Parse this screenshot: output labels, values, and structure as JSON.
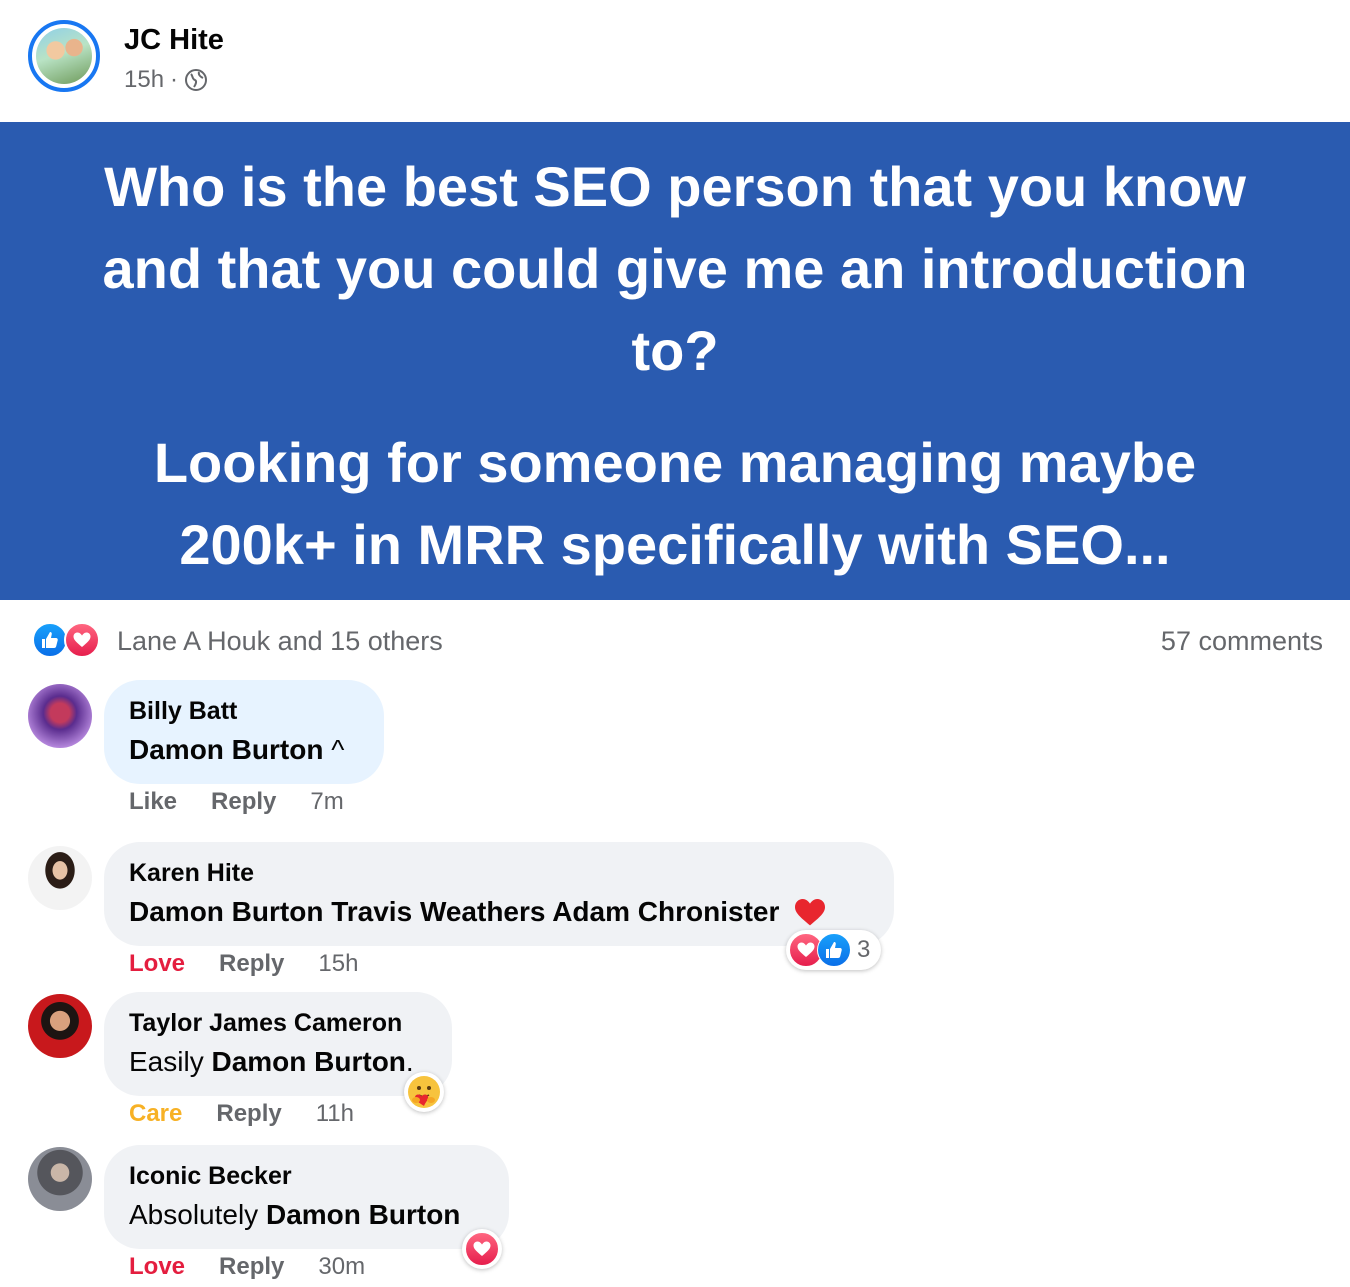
{
  "post": {
    "author": "JC Hite",
    "time": "15h",
    "separator": "·",
    "banner_color": "#2a5bb0",
    "question_lines": [
      "Who is the best SEO person that you know",
      "and that you could give me an introduction",
      "to?"
    ],
    "detail_lines": [
      "Looking for someone managing maybe",
      "200k+ in MRR specifically with SEO..."
    ]
  },
  "summary": {
    "reactors": "Lane A Houk and 15 others",
    "comments_count": "57 comments",
    "icons": [
      "like-icon",
      "love-icon"
    ]
  },
  "comments": [
    {
      "name": "Billy Batt",
      "text_prefix": "",
      "mention": "Damon Burton",
      "text_suffix": " ^",
      "reaction_action": "Like",
      "reply_label": "Reply",
      "time": "7m"
    },
    {
      "name": "Karen Hite",
      "text_prefix": "",
      "mention": "Damon Burton  Travis Weathers Adam Chronister",
      "text_suffix": "",
      "reaction_action": "Love",
      "reply_label": "Reply",
      "time": "15h",
      "reaction_count": "3"
    },
    {
      "name": "Taylor James Cameron",
      "text_prefix": "Easily ",
      "mention": "Damon Burton",
      "text_suffix": ".",
      "reaction_action": "Care",
      "reply_label": "Reply",
      "time": "11h"
    },
    {
      "name": "Iconic Becker",
      "text_prefix": "Absolutely ",
      "mention": "Damon Burton",
      "text_suffix": "",
      "reaction_action": "Love",
      "reply_label": "Reply",
      "time": "30m"
    }
  ],
  "colors": {
    "accent": "#1877f2",
    "love": "#e41e3f",
    "care": "#f7b125",
    "muted": "#65676b"
  }
}
